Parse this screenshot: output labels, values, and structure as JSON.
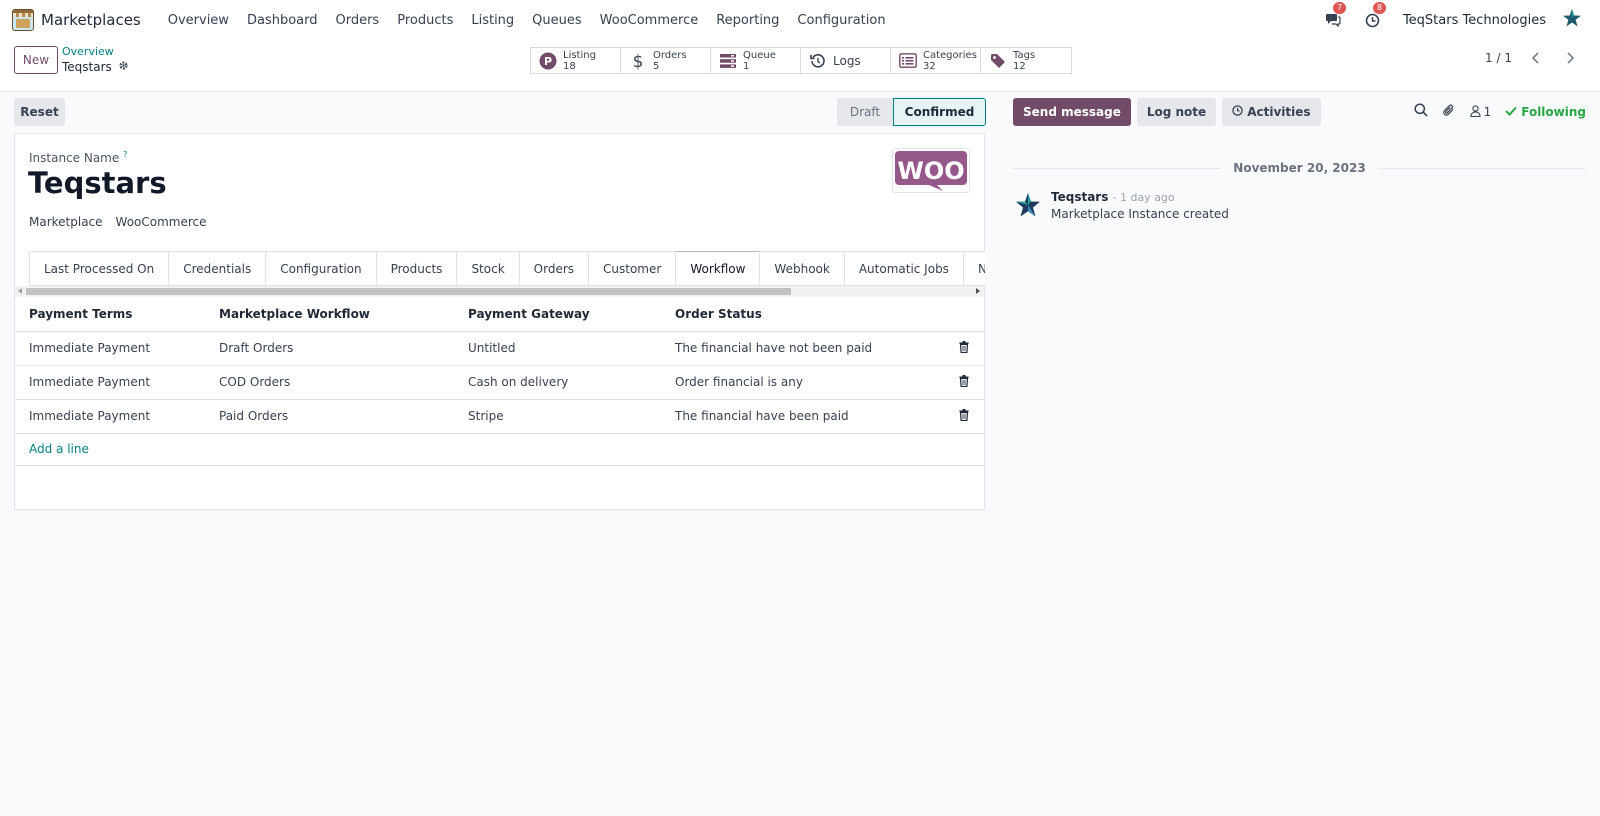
{
  "navbar": {
    "app_name": "Marketplaces",
    "menu": [
      "Overview",
      "Dashboard",
      "Orders",
      "Products",
      "Listing",
      "Queues",
      "WooCommerce",
      "Reporting",
      "Configuration"
    ],
    "messages_badge": "7",
    "activities_badge": "8",
    "company": "TeqStars Technologies"
  },
  "control_panel": {
    "new_label": "New",
    "breadcrumb_parent": "Overview",
    "breadcrumb_current": "Teqstars",
    "smart_buttons": [
      {
        "label": "Listing",
        "value": "18",
        "icon": "listing-p-icon"
      },
      {
        "label": "Orders",
        "value": "5",
        "icon": "dollar-icon"
      },
      {
        "label": "Queue",
        "value": "1",
        "icon": "queue-icon"
      },
      {
        "label": "Logs",
        "value": "",
        "icon": "history-icon"
      },
      {
        "label": "Categories",
        "value": "32",
        "icon": "list-icon"
      },
      {
        "label": "Tags",
        "value": "12",
        "icon": "tag-icon"
      }
    ],
    "pager": "1 / 1"
  },
  "form": {
    "reset_label": "Reset",
    "status": {
      "draft": "Draft",
      "confirmed": "Confirmed",
      "current": "Confirmed"
    },
    "instance_name_label": "Instance Name",
    "instance_name_help": "?",
    "instance_name": "Teqstars",
    "marketplace_label": "Marketplace",
    "marketplace_value": "WooCommerce",
    "logo_text": "WOO",
    "tabs": [
      "Last Processed On",
      "Credentials",
      "Configuration",
      "Products",
      "Stock",
      "Orders",
      "Customer",
      "Workflow",
      "Webhook",
      "Automatic Jobs",
      "Notifications"
    ],
    "active_tab": "Workflow",
    "table": {
      "headers": [
        "Payment Terms",
        "Marketplace Workflow",
        "Payment Gateway",
        "Order Status"
      ],
      "rows": [
        [
          "Immediate Payment",
          "Draft Orders",
          "Untitled",
          "The financial have not been paid"
        ],
        [
          "Immediate Payment",
          "COD Orders",
          "Cash on delivery",
          "Order financial is any"
        ],
        [
          "Immediate Payment",
          "Paid Orders",
          "Stripe",
          "The financial have been paid"
        ]
      ],
      "add_line": "Add a line"
    }
  },
  "chatter": {
    "send_message": "Send message",
    "log_note": "Log note",
    "activities": "Activities",
    "followers_count": "1",
    "following": "Following",
    "date": "November 20, 2023",
    "message": {
      "author": "Teqstars",
      "time": "- 1 day ago",
      "body": "Marketplace Instance created"
    }
  },
  "colors": {
    "brand": "#714b67",
    "link": "#017e84",
    "success": "#28a745",
    "badge": "#e05555",
    "woo": "#96588a"
  }
}
